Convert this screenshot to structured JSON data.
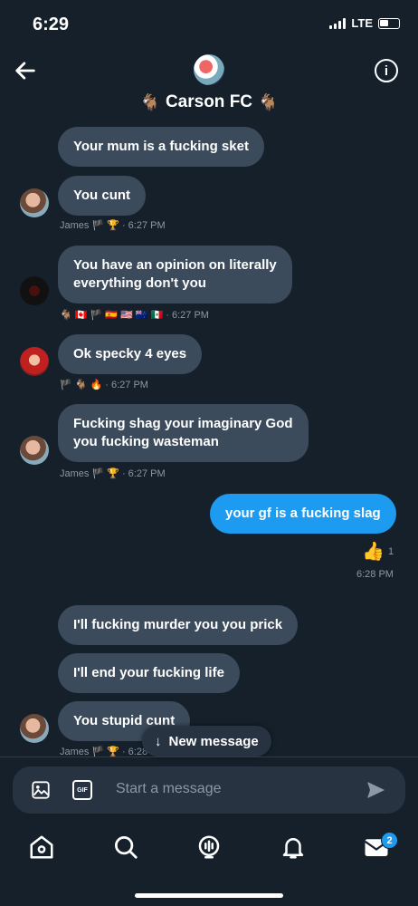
{
  "status": {
    "time": "6:29",
    "network": "LTE"
  },
  "header": {
    "title": "Carson FC",
    "title_emoji": "🐐"
  },
  "messages": [
    {
      "text": "Your mum is a fucking sket"
    },
    {
      "text": "You cunt",
      "meta": "James 🏴 🏆 · 6:27 PM"
    },
    {
      "text_line1": "You have an opinion on literally",
      "text_line2": "everything don't you",
      "meta": "🐐 🇨🇦 🏴 🇪🇸 🇺🇸 🇳🇿 🇲🇽 · 6:27 PM"
    },
    {
      "text": "Ok specky 4 eyes",
      "meta": "🏴 🐐 🔥 · 6:27 PM"
    },
    {
      "text_line1": "Fucking shag your imaginary God",
      "text_line2": "you fucking wasteman",
      "meta": "James 🏴 🏆 · 6:27 PM"
    },
    {
      "text": "your gf is a fucking slag",
      "reaction": "👍",
      "reaction_count": "1",
      "time": "6:28 PM"
    },
    {
      "text": "I'll fucking murder you you prick"
    },
    {
      "text": "I'll end your fucking life"
    },
    {
      "text": "You stupid cunt",
      "meta": "James 🏴 🏆 · 6:28"
    }
  ],
  "new_message": {
    "arrow": "↓",
    "label": "New message"
  },
  "composer": {
    "placeholder": "Start a message",
    "gif_label": "GIF"
  },
  "tabs": {
    "badge": "2"
  },
  "colors": {
    "background": "#15202b",
    "bubble_other": "#3b4b5c",
    "bubble_mine": "#1d9bf0",
    "muted": "#8b98a5"
  }
}
